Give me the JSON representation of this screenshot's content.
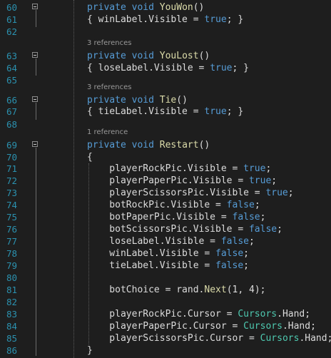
{
  "editor": {
    "lines": [
      {
        "num": "60",
        "fold": true,
        "html": "<span class='kw'>private</span> <span class='kw'>void</span> <span class='mth'>YouWon</span>()"
      },
      {
        "num": "61",
        "fold": false,
        "html": "{ winLabel.Visible = <span class='kw'>true</span>; }"
      },
      {
        "num": "62",
        "fold": false,
        "html": ""
      },
      {
        "num": "63",
        "fold": true,
        "refs": "3 references",
        "html": "<span class='kw'>private</span> <span class='kw'>void</span> <span class='mth'>YouLost</span>()"
      },
      {
        "num": "64",
        "fold": false,
        "html": "{ loseLabel.Visible = <span class='kw'>true</span>; }"
      },
      {
        "num": "65",
        "fold": false,
        "html": ""
      },
      {
        "num": "66",
        "fold": true,
        "refs": "3 references",
        "html": "<span class='kw'>private</span> <span class='kw'>void</span> <span class='mth'>Tie</span>()"
      },
      {
        "num": "67",
        "fold": false,
        "html": "{ tieLabel.Visible = <span class='kw'>true</span>; }"
      },
      {
        "num": "68",
        "fold": false,
        "html": ""
      },
      {
        "num": "69",
        "fold": true,
        "refs": "1 reference",
        "html": "<span class='kw'>private</span> <span class='kw'>void</span> <span class='mth'>Restart</span>()"
      },
      {
        "num": "70",
        "fold": false,
        "html": "{"
      },
      {
        "num": "71",
        "fold": false,
        "html": "    playerRockPic.Visible = <span class='kw'>true</span>;"
      },
      {
        "num": "72",
        "fold": false,
        "html": "    playerPaperPic.Visible = <span class='kw'>true</span>;"
      },
      {
        "num": "73",
        "fold": false,
        "html": "    playerScissorsPic.Visible = <span class='kw'>true</span>;"
      },
      {
        "num": "74",
        "fold": false,
        "html": "    botRockPic.Visible = <span class='kw'>false</span>;"
      },
      {
        "num": "75",
        "fold": false,
        "html": "    botPaperPic.Visible = <span class='kw'>false</span>;"
      },
      {
        "num": "76",
        "fold": false,
        "html": "    botScissorsPic.Visible = <span class='kw'>false</span>;"
      },
      {
        "num": "77",
        "fold": false,
        "html": "    loseLabel.Visible = <span class='kw'>false</span>;"
      },
      {
        "num": "78",
        "fold": false,
        "html": "    winLabel.Visible = <span class='kw'>false</span>;"
      },
      {
        "num": "79",
        "fold": false,
        "html": "    tieLabel.Visible = <span class='kw'>false</span>;"
      },
      {
        "num": "80",
        "fold": false,
        "html": ""
      },
      {
        "num": "81",
        "fold": false,
        "html": "    botChoice = rand.<span class='mth'>Next</span>(1, 4);"
      },
      {
        "num": "82",
        "fold": false,
        "html": ""
      },
      {
        "num": "83",
        "fold": false,
        "html": "    playerRockPic.Cursor = <span class='typ'>Cursors</span>.Hand;"
      },
      {
        "num": "84",
        "fold": false,
        "html": "    playerPaperPic.Cursor = <span class='typ'>Cursors</span>.Hand;"
      },
      {
        "num": "85",
        "fold": false,
        "html": "    playerScissorsPic.Cursor = <span class='typ'>Cursors</span>.Hand;"
      },
      {
        "num": "86",
        "fold": false,
        "html": "}"
      }
    ]
  },
  "colors": {
    "background": "#1e1e1e",
    "line_number": "#2b91af",
    "keyword": "#569cd6",
    "method": "#dcdcaa",
    "type": "#4ec9b0",
    "identifier": "#dcdcdc",
    "codelens": "#999999"
  }
}
